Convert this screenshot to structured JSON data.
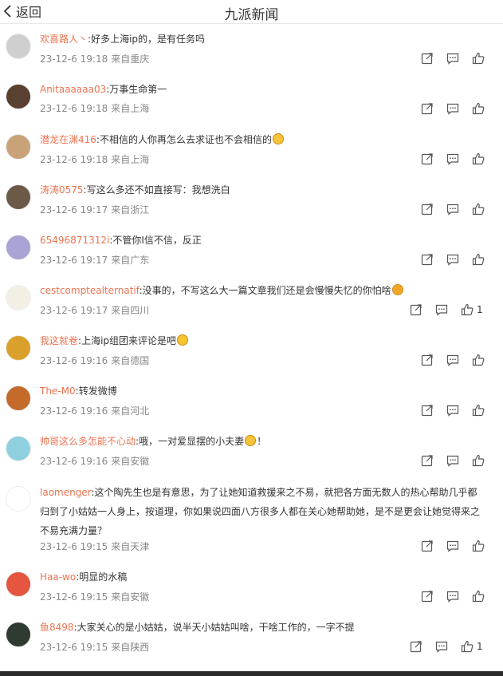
{
  "header": {
    "back_label": "返回",
    "title": "九派新闻"
  },
  "comments": [
    {
      "user": "欢喜路人丶",
      "text": "好多上海ip的，是有任务吗",
      "emoji": "",
      "text_after": "",
      "date": "23-12-6 19:18",
      "location": "来自重庆",
      "likes": "",
      "avatar_color": "#cfcfcf"
    },
    {
      "user": "Anitaaaaaa03",
      "text": "万事生命第一",
      "emoji": "",
      "text_after": "",
      "date": "23-12-6 19:18",
      "location": "来自上海",
      "likes": "",
      "avatar_color": "#5a4030"
    },
    {
      "user": "潜龙在渊416",
      "text": "不相信的人你再怎么去求证也不会相信的",
      "emoji": "sweat-smile-emoji",
      "text_after": "",
      "date": "23-12-6 19:18",
      "location": "来自上海",
      "likes": "",
      "avatar_color": "#c9a27a"
    },
    {
      "user": "涛涛0575",
      "text": "写这么多还不如直接写：我想洗白",
      "emoji": "",
      "text_after": "",
      "date": "23-12-6 19:17",
      "location": "来自浙江",
      "likes": "",
      "avatar_color": "#6b5a48"
    },
    {
      "user": "65496871312i",
      "text": "不管你I信不信，反正",
      "emoji": "",
      "text_after": "",
      "date": "23-12-6 19:17",
      "location": "来自广东",
      "likes": "",
      "avatar_color": "#a9a3d6"
    },
    {
      "user": "cestcomptealternatif",
      "text": "没事的，不写这么大一篇文章我们还是会慢慢失忆的你怕啥",
      "emoji": "shush-emoji",
      "text_after": "",
      "date": "23-12-6 19:17",
      "location": "来自四川",
      "likes": "1",
      "avatar_color": "#f3efe4"
    },
    {
      "user": "我这就卷",
      "text": "上海ip组团来评论是吧",
      "emoji": "grimace-emoji",
      "text_after": "",
      "date": "23-12-6 19:16",
      "location": "来自德国",
      "likes": "",
      "avatar_color": "#d9a12b"
    },
    {
      "user": "The-M0",
      "text": "转发微博",
      "emoji": "",
      "text_after": "",
      "date": "23-12-6 19:16",
      "location": "来自河北",
      "likes": "",
      "avatar_color": "#c46a2a"
    },
    {
      "user": "帅哥这么多怎能不心动",
      "text": "哦，一对爱显摆的小夫妻",
      "emoji": "smirk-emoji",
      "text_after": "！",
      "date": "23-12-6 19:16",
      "location": "来自安徽",
      "likes": "",
      "avatar_color": "#8fd0e0"
    },
    {
      "user": "laomenger",
      "text": "这个陶先生也是有意思，为了让她知道救援来之不易，就把各方面无数人的热心帮助几乎都归到了小姑姑一人身上，按道理，你如果说四面八方很多人都在关心她帮助她，是不是更会让她觉得来之不易充满力量？",
      "emoji": "",
      "text_after": "",
      "date": "23-12-6 19:15",
      "location": "来自天津",
      "likes": "",
      "avatar_color": "#ffffff"
    },
    {
      "user": "Haa-wo",
      "text": "明显的水稿",
      "emoji": "",
      "text_after": "",
      "date": "23-12-6 19:15",
      "location": "来自安徽",
      "likes": "",
      "avatar_color": "#e6553f"
    },
    {
      "user": "鱼8498",
      "text": "大家关心的是小姑姑，说半天小姑姑叫啥，干啥工作的，一字不提",
      "emoji": "",
      "text_after": "",
      "date": "23-12-6 19:15",
      "location": "来自陕西",
      "likes": "1",
      "avatar_color": "#2f3a30"
    }
  ],
  "icons": {
    "share": "share-icon",
    "comment": "comment-icon",
    "like": "thumbs-up-icon",
    "back": "chevron-left-icon"
  }
}
